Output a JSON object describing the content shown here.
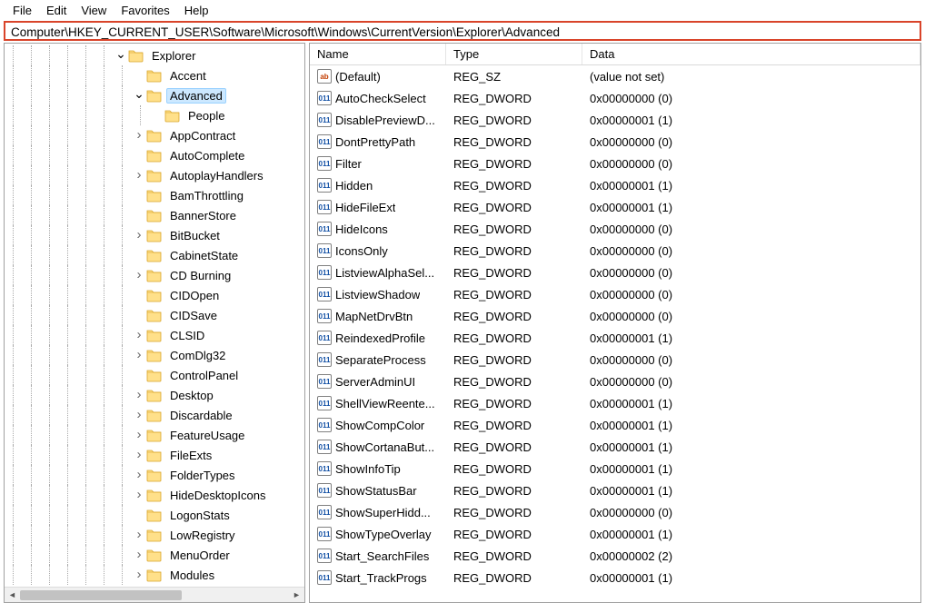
{
  "menu": {
    "file": "File",
    "edit": "Edit",
    "view": "View",
    "favorites": "Favorites",
    "help": "Help"
  },
  "address": "Computer\\HKEY_CURRENT_USER\\Software\\Microsoft\\Windows\\CurrentVersion\\Explorer\\Advanced",
  "tree": [
    {
      "depth": 6,
      "expander": "open",
      "label": "Explorer",
      "selected": false
    },
    {
      "depth": 7,
      "expander": "none",
      "label": "Accent",
      "selected": false
    },
    {
      "depth": 7,
      "expander": "open",
      "label": "Advanced",
      "selected": true
    },
    {
      "depth": 8,
      "expander": "none",
      "label": "People",
      "selected": false
    },
    {
      "depth": 7,
      "expander": "closed",
      "label": "AppContract",
      "selected": false
    },
    {
      "depth": 7,
      "expander": "none",
      "label": "AutoComplete",
      "selected": false
    },
    {
      "depth": 7,
      "expander": "closed",
      "label": "AutoplayHandlers",
      "selected": false
    },
    {
      "depth": 7,
      "expander": "none",
      "label": "BamThrottling",
      "selected": false
    },
    {
      "depth": 7,
      "expander": "none",
      "label": "BannerStore",
      "selected": false
    },
    {
      "depth": 7,
      "expander": "closed",
      "label": "BitBucket",
      "selected": false
    },
    {
      "depth": 7,
      "expander": "none",
      "label": "CabinetState",
      "selected": false
    },
    {
      "depth": 7,
      "expander": "closed",
      "label": "CD Burning",
      "selected": false
    },
    {
      "depth": 7,
      "expander": "none",
      "label": "CIDOpen",
      "selected": false
    },
    {
      "depth": 7,
      "expander": "none",
      "label": "CIDSave",
      "selected": false
    },
    {
      "depth": 7,
      "expander": "closed",
      "label": "CLSID",
      "selected": false
    },
    {
      "depth": 7,
      "expander": "closed",
      "label": "ComDlg32",
      "selected": false
    },
    {
      "depth": 7,
      "expander": "none",
      "label": "ControlPanel",
      "selected": false
    },
    {
      "depth": 7,
      "expander": "closed",
      "label": "Desktop",
      "selected": false
    },
    {
      "depth": 7,
      "expander": "closed",
      "label": "Discardable",
      "selected": false
    },
    {
      "depth": 7,
      "expander": "closed",
      "label": "FeatureUsage",
      "selected": false
    },
    {
      "depth": 7,
      "expander": "closed",
      "label": "FileExts",
      "selected": false
    },
    {
      "depth": 7,
      "expander": "closed",
      "label": "FolderTypes",
      "selected": false
    },
    {
      "depth": 7,
      "expander": "closed",
      "label": "HideDesktopIcons",
      "selected": false
    },
    {
      "depth": 7,
      "expander": "none",
      "label": "LogonStats",
      "selected": false
    },
    {
      "depth": 7,
      "expander": "closed",
      "label": "LowRegistry",
      "selected": false
    },
    {
      "depth": 7,
      "expander": "closed",
      "label": "MenuOrder",
      "selected": false
    },
    {
      "depth": 7,
      "expander": "closed",
      "label": "Modules",
      "selected": false
    }
  ],
  "columns": {
    "name": "Name",
    "type": "Type",
    "data": "Data"
  },
  "values": [
    {
      "icon": "sz",
      "name": "(Default)",
      "type": "REG_SZ",
      "data": "(value not set)"
    },
    {
      "icon": "dw",
      "name": "AutoCheckSelect",
      "type": "REG_DWORD",
      "data": "0x00000000 (0)"
    },
    {
      "icon": "dw",
      "name": "DisablePreviewD...",
      "type": "REG_DWORD",
      "data": "0x00000001 (1)"
    },
    {
      "icon": "dw",
      "name": "DontPrettyPath",
      "type": "REG_DWORD",
      "data": "0x00000000 (0)"
    },
    {
      "icon": "dw",
      "name": "Filter",
      "type": "REG_DWORD",
      "data": "0x00000000 (0)"
    },
    {
      "icon": "dw",
      "name": "Hidden",
      "type": "REG_DWORD",
      "data": "0x00000001 (1)"
    },
    {
      "icon": "dw",
      "name": "HideFileExt",
      "type": "REG_DWORD",
      "data": "0x00000001 (1)"
    },
    {
      "icon": "dw",
      "name": "HideIcons",
      "type": "REG_DWORD",
      "data": "0x00000000 (0)"
    },
    {
      "icon": "dw",
      "name": "IconsOnly",
      "type": "REG_DWORD",
      "data": "0x00000000 (0)"
    },
    {
      "icon": "dw",
      "name": "ListviewAlphaSel...",
      "type": "REG_DWORD",
      "data": "0x00000000 (0)"
    },
    {
      "icon": "dw",
      "name": "ListviewShadow",
      "type": "REG_DWORD",
      "data": "0x00000000 (0)"
    },
    {
      "icon": "dw",
      "name": "MapNetDrvBtn",
      "type": "REG_DWORD",
      "data": "0x00000000 (0)"
    },
    {
      "icon": "dw",
      "name": "ReindexedProfile",
      "type": "REG_DWORD",
      "data": "0x00000001 (1)"
    },
    {
      "icon": "dw",
      "name": "SeparateProcess",
      "type": "REG_DWORD",
      "data": "0x00000000 (0)"
    },
    {
      "icon": "dw",
      "name": "ServerAdminUI",
      "type": "REG_DWORD",
      "data": "0x00000000 (0)"
    },
    {
      "icon": "dw",
      "name": "ShellViewReente...",
      "type": "REG_DWORD",
      "data": "0x00000001 (1)"
    },
    {
      "icon": "dw",
      "name": "ShowCompColor",
      "type": "REG_DWORD",
      "data": "0x00000001 (1)"
    },
    {
      "icon": "dw",
      "name": "ShowCortanaBut...",
      "type": "REG_DWORD",
      "data": "0x00000001 (1)"
    },
    {
      "icon": "dw",
      "name": "ShowInfoTip",
      "type": "REG_DWORD",
      "data": "0x00000001 (1)"
    },
    {
      "icon": "dw",
      "name": "ShowStatusBar",
      "type": "REG_DWORD",
      "data": "0x00000001 (1)"
    },
    {
      "icon": "dw",
      "name": "ShowSuperHidd...",
      "type": "REG_DWORD",
      "data": "0x00000000 (0)"
    },
    {
      "icon": "dw",
      "name": "ShowTypeOverlay",
      "type": "REG_DWORD",
      "data": "0x00000001 (1)"
    },
    {
      "icon": "dw",
      "name": "Start_SearchFiles",
      "type": "REG_DWORD",
      "data": "0x00000002 (2)"
    },
    {
      "icon": "dw",
      "name": "Start_TrackProgs",
      "type": "REG_DWORD",
      "data": "0x00000001 (1)"
    }
  ],
  "iconGlyphs": {
    "sz": "ab",
    "dw": "011"
  }
}
